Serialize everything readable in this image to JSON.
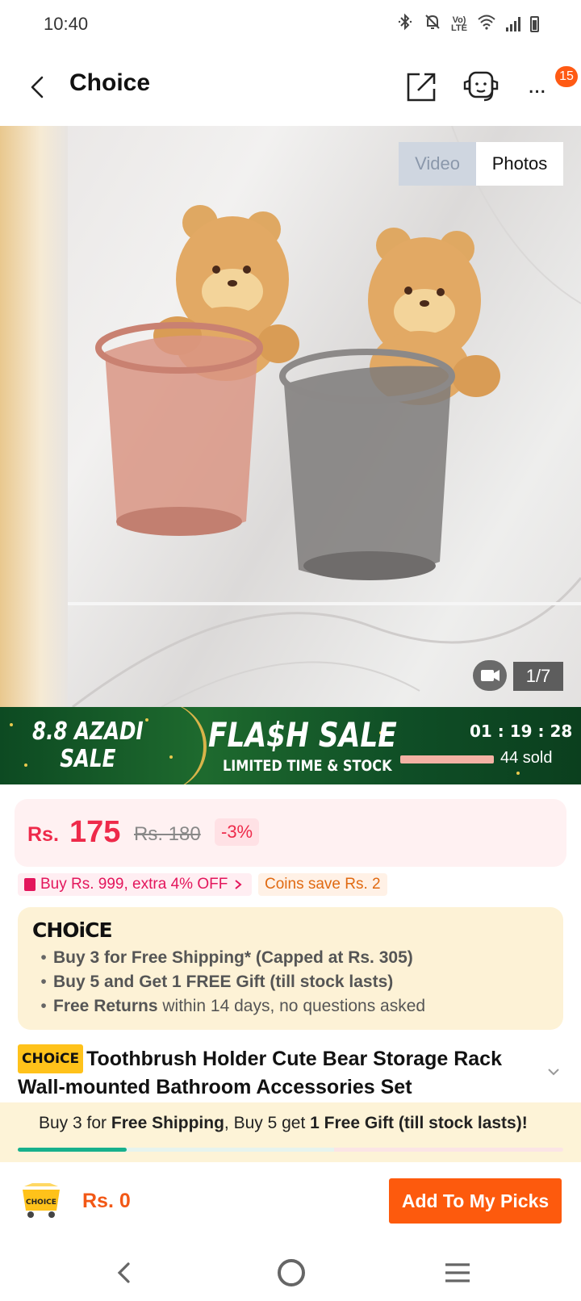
{
  "status_bar": {
    "time": "10:40",
    "icons": [
      "bluetooth-icon",
      "mute-icon",
      "volte-icon",
      "wifi-icon",
      "signal-icon",
      "battery-icon"
    ],
    "volte_label_top": "Vo)",
    "volte_label_bottom": "LTE"
  },
  "header": {
    "title": "Choice",
    "badge_count": "15",
    "more_label": "..."
  },
  "gallery": {
    "tab_video": "Video",
    "tab_photos": "Photos",
    "active_tab": "Photos",
    "counter": "1/7"
  },
  "flash_sale": {
    "event_line1": "8.8 AZADI",
    "event_line2": "SALE",
    "title": "FLA$H SALE",
    "subtitle": "LIMITED TIME & STOCK",
    "timer": "01 : 19 : 28",
    "sold": "44 sold",
    "colors": {
      "bg": "#0f4e26",
      "bar": "#f3b2a4"
    }
  },
  "price": {
    "currency": "Rs.",
    "amount": "175",
    "original": "Rs. 180",
    "discount": "-3%",
    "color": "#ee2a4a"
  },
  "coupons": {
    "coupon_label": "Buy Rs. 999, extra 4% OFF",
    "coins_label": "Coins save Rs. 2"
  },
  "choice_box": {
    "logo": "CHOiCE",
    "line1": "Buy 3 for  Free Shipping* (Capped at Rs. 305)",
    "line2": "Buy 5 and Get 1 FREE Gift (till stock lasts)",
    "line3_bold": "Free Returns",
    "line3_rest": " within 14 days, no questions asked"
  },
  "product": {
    "tag": "CHOiCE",
    "title": "Toothbrush Holder Cute Bear Storage Rack Wall-mounted Bathroom Accessories Set"
  },
  "promo_strip": {
    "p1": "Buy 3 for ",
    "p2": "Free Shipping",
    "p3": ", Buy 5 get ",
    "p4": "1 Free Gift (till stock lasts)!",
    "progress": 0.2
  },
  "action_bar": {
    "cart_label": "CHOICE",
    "total": "Rs. 0",
    "add_button": "Add To My Picks",
    "accent": "#fd5a0d"
  }
}
